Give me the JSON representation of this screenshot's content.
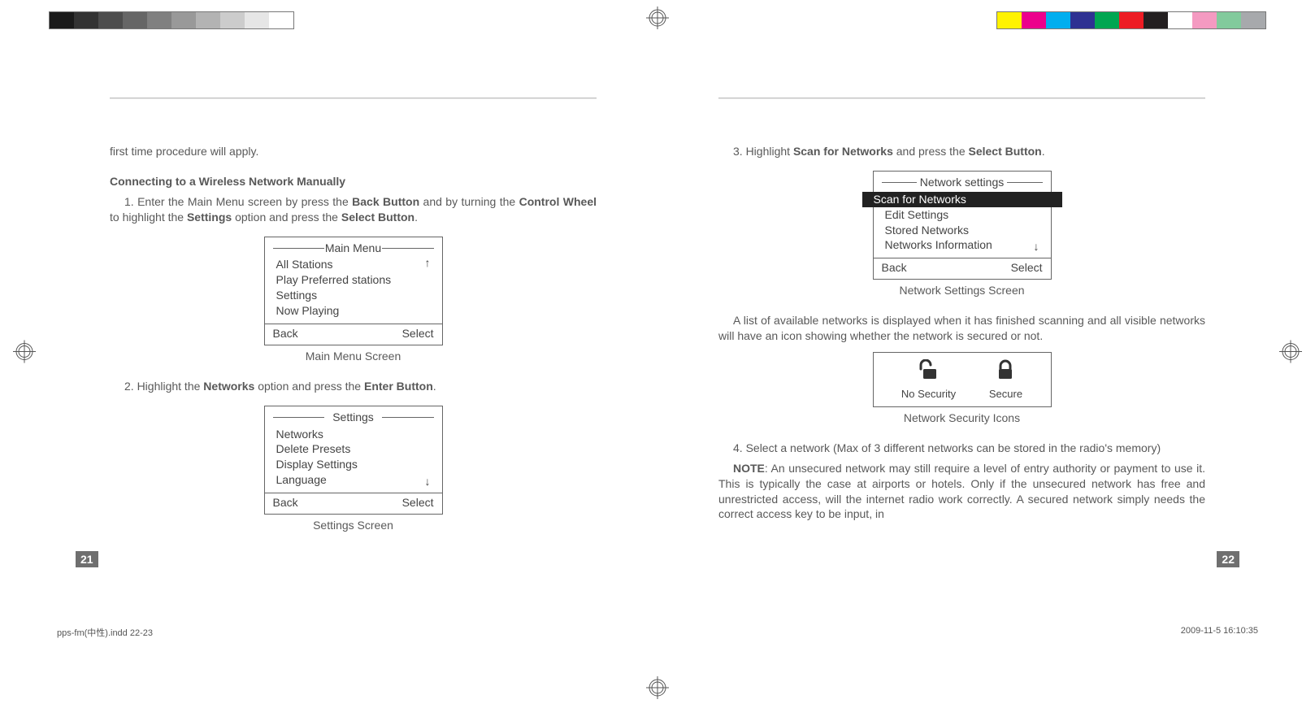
{
  "pageLeft": {
    "intro": "first time procedure will apply.",
    "heading": "Connecting to a Wireless Network Manually",
    "step1_pre": "1. Enter the Main Menu screen by press the ",
    "step1_b1": "Back Button",
    "step1_mid": " and by turning the ",
    "step1_b2": "Control Wheel",
    "step1_mid2": " to highlight the ",
    "step1_b3": "Settings",
    "step1_mid3": " option and press the ",
    "step1_b4": "Select Button",
    "step1_end": ".",
    "mainMenu": {
      "title": "Main Menu",
      "items": [
        "All Stations",
        "Play Preferred stations",
        "Settings",
        "Now Playing"
      ],
      "arrowUp": "↑",
      "back": "Back",
      "select": "Select",
      "caption": "Main Menu Screen"
    },
    "step2_pre": "2. Highlight the ",
    "step2_b1": "Networks",
    "step2_mid": " option and press the ",
    "step2_b2": "Enter Button",
    "step2_end": ".",
    "settingsMenu": {
      "title": "Settings",
      "items": [
        "Networks",
        "Delete Presets",
        "Display Settings",
        "Language"
      ],
      "arrowDown": "↓",
      "back": "Back",
      "select": "Select",
      "caption": "Settings Screen"
    },
    "pageNumber": "21"
  },
  "pageRight": {
    "step3_pre": "3. Highlight ",
    "step3_b1": "Scan for Networks",
    "step3_mid": " and press the ",
    "step3_b2": "Select Button",
    "step3_end": ".",
    "networkMenu": {
      "title": "Network settings",
      "selected": "Scan for Networks",
      "items": [
        "Edit Settings",
        "Stored Networks",
        "Networks Information"
      ],
      "arrowDown": "↓",
      "back": "Back",
      "select": "Select",
      "caption": "Network Settings Screen"
    },
    "para1": "A list of available networks is displayed when it has finished scanning and all visible networks will have an icon showing whether the network is secured or not.",
    "icons": {
      "noSecurity": "No Security",
      "secure": "Secure",
      "caption": "Network Security Icons"
    },
    "para2": "4. Select a network (Max of 3 different networks can be stored in the radio's memory)",
    "noteLabel": "NOTE",
    "notePara": ": An unsecured network may still require a level of entry authority or payment to use it. This is typically the case at airports or hotels. Only if the unsecured network has free and unrestricted access, will the internet radio work correctly. A secured network simply needs the correct access key to be input, in",
    "pageNumber": "22"
  },
  "footer": {
    "file": "pps-fm(中性).indd   22-23",
    "timestamp": "2009-11-5   16:10:35"
  },
  "greyBar": [
    "#1a1a1a",
    "#333333",
    "#4d4d4d",
    "#666666",
    "#808080",
    "#999999",
    "#b3b3b3",
    "#cccccc",
    "#e6e6e6",
    "#ffffff"
  ],
  "colorBar": [
    "#fff200",
    "#ec008c",
    "#00aeef",
    "#2e3192",
    "#00a651",
    "#ed1c24",
    "#231f20",
    "#ffffff",
    "#f49ac1",
    "#82ca9c",
    "#a7a9ac"
  ]
}
